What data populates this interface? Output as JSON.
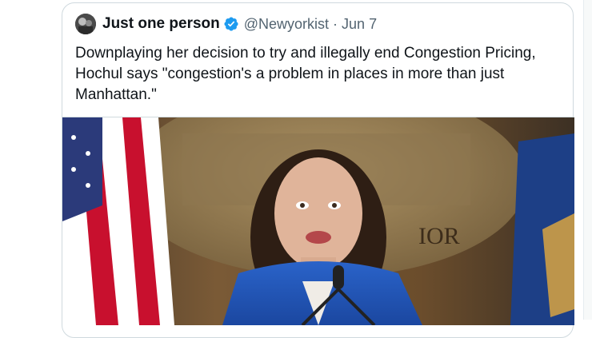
{
  "tweet": {
    "display_name": "Just one person",
    "handle": "@Newyorkist",
    "separator": "·",
    "date": "Jun 7",
    "text": "Downplaying her decision to try and illegally end Congestion Pricing,\nHochul says \"congestion's a problem in places in more than just\nManhattan.\"",
    "verified_icon": "verified-badge-icon",
    "accent_color": "#1d9bf0"
  },
  "media": {
    "type": "video-frame",
    "seal_text": "IOR"
  }
}
